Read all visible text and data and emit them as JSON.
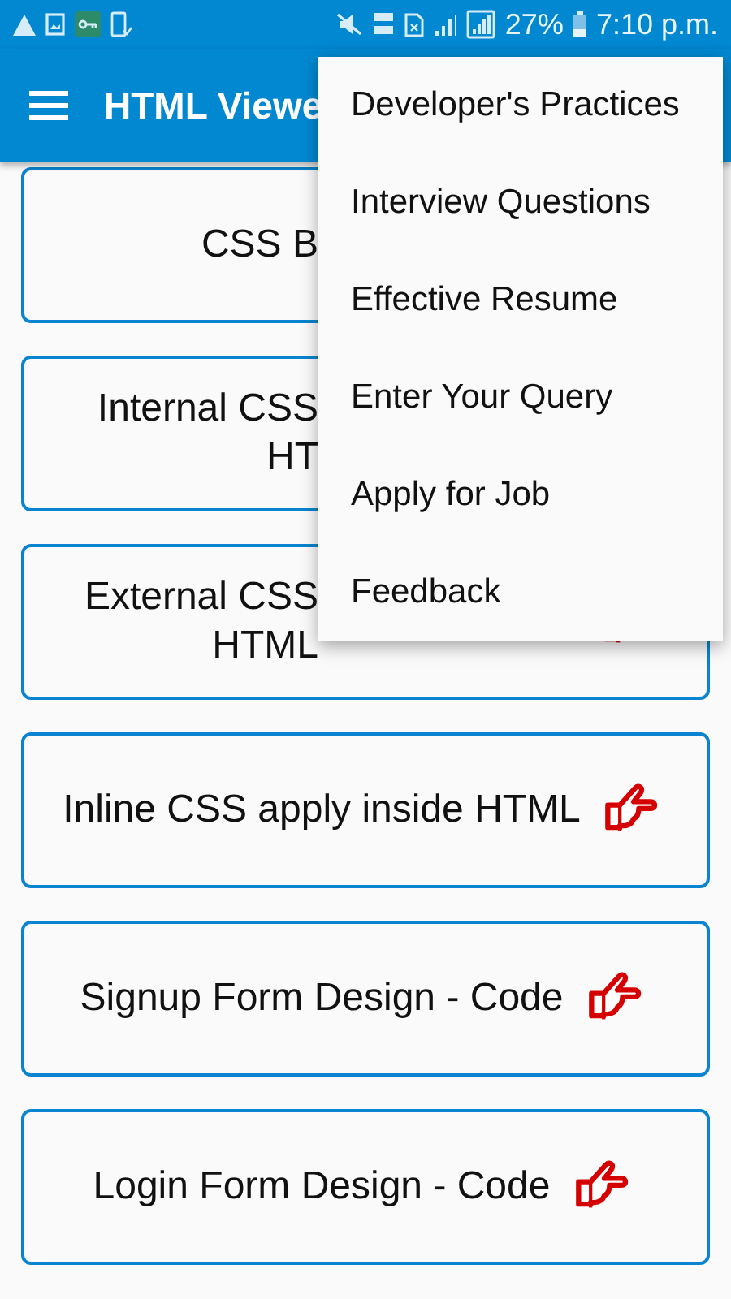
{
  "status_bar": {
    "battery": "27%",
    "time": "7:10 p.m."
  },
  "app_bar": {
    "title": "HTML Viewe"
  },
  "cards": [
    {
      "kind": "covered",
      "lines": [
        "CSS B"
      ],
      "pointer": false
    },
    {
      "kind": "covered",
      "lines": [
        "Internal CSS",
        "HT"
      ],
      "pointer": false
    },
    {
      "kind": "covered",
      "lines": [
        "External CSS",
        "HTML"
      ],
      "pointer": true
    },
    {
      "kind": "full",
      "lines": [
        "Inline CSS apply inside HTML"
      ],
      "pointer": true
    },
    {
      "kind": "full",
      "lines": [
        "Signup Form Design - Code"
      ],
      "pointer": true
    },
    {
      "kind": "full",
      "lines": [
        "Login Form Design - Code"
      ],
      "pointer": true
    }
  ],
  "menu": {
    "items": [
      "Developer's Practices",
      "Interview Questions",
      "Effective Resume",
      "Enter Your Query",
      "Apply for Job",
      "Feedback"
    ]
  }
}
